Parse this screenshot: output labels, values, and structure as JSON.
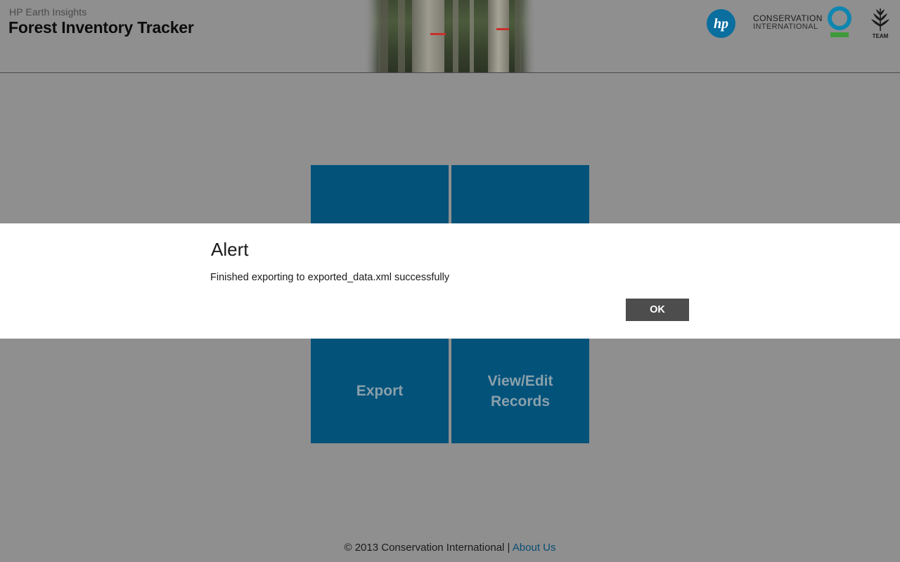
{
  "header": {
    "subtitle": "HP Earth Insights",
    "title": "Forest Inventory Tracker",
    "banner_image": "forest-banner-image",
    "logos": {
      "hp": "hp-logo",
      "conservation_line1": "CONSERVATION",
      "conservation_line2": "INTERNATIONAL",
      "team_label": "TEAM"
    }
  },
  "tiles": [
    {
      "label": ""
    },
    {
      "label": ""
    },
    {
      "label": "Export"
    },
    {
      "label": "View/Edit Records"
    }
  ],
  "alert": {
    "title": "Alert",
    "message": "Finished exporting to exported_data.xml successfully",
    "ok_label": "OK"
  },
  "footer": {
    "copyright": "© 2013 Conservation International |",
    "about_link": "About Us"
  },
  "colors": {
    "overlay_background": "#8f8f8f",
    "tile": "#02527a",
    "ok_button": "#4d4d4d",
    "link": "#0a4d73"
  }
}
